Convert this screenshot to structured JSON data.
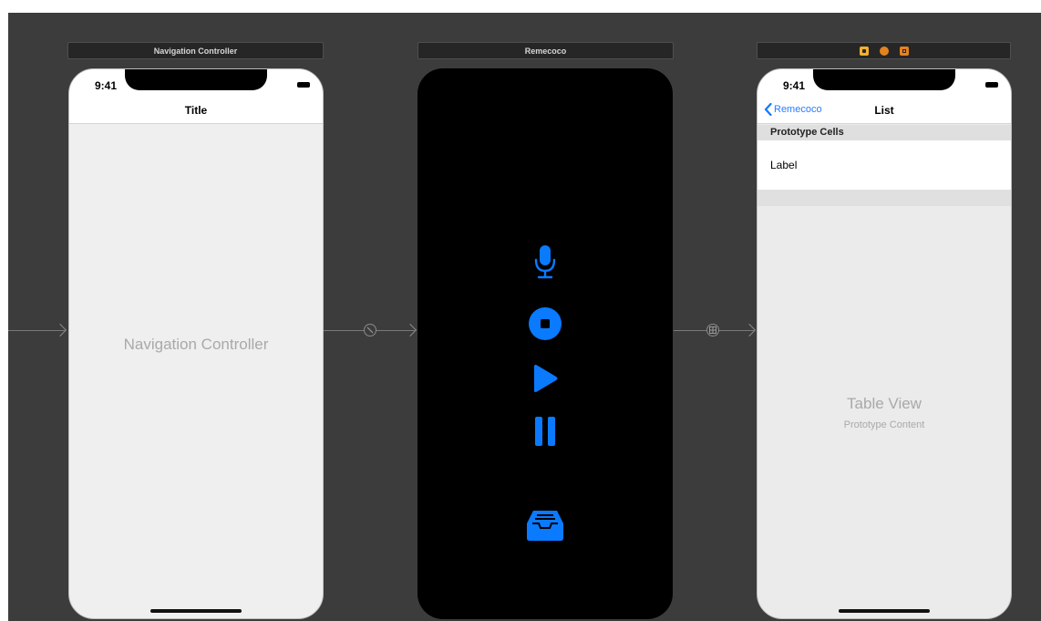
{
  "scenes": {
    "navigation": {
      "bar_title": "Navigation Controller",
      "status_time": "9:41",
      "nav_title": "Title",
      "placeholder": "Navigation Controller"
    },
    "remecoco": {
      "bar_title": "Remecoco",
      "icons": [
        "microphone-icon",
        "stop-icon",
        "play-icon",
        "pause-icon",
        "tray-icon"
      ]
    },
    "list": {
      "status_time": "9:41",
      "back_label": "Remecoco",
      "nav_title": "List",
      "section_header": "Prototype Cells",
      "cell_label": "Label",
      "table_title": "Table View",
      "table_subtitle": "Prototype Content",
      "bar_icons": [
        "view-controller-icon",
        "first-responder-icon",
        "exit-icon"
      ]
    }
  },
  "colors": {
    "accent": "#0a7aff",
    "canvas": "#3c3c3c",
    "phone_light": "#efefef",
    "bar_icon_yellow": "#f0b030",
    "bar_icon_orange": "#e6821e"
  }
}
